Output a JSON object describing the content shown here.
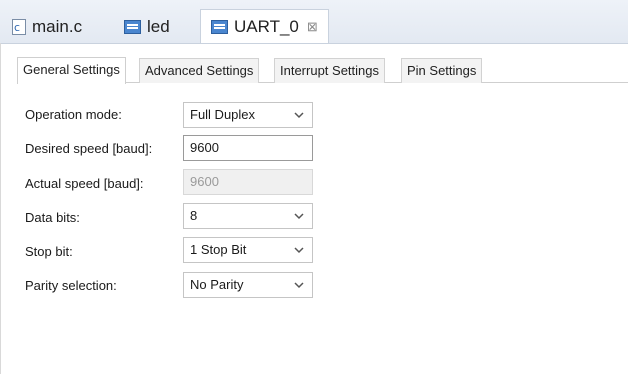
{
  "editor_tabs": [
    {
      "label": "main.c",
      "icon": "c-file-icon",
      "active": false
    },
    {
      "label": "led",
      "icon": "component-icon",
      "active": false
    },
    {
      "label": "UART_0",
      "icon": "component-icon",
      "active": true,
      "close": "⊠"
    }
  ],
  "settings_tabs": [
    {
      "label": "General Settings",
      "active": true
    },
    {
      "label": "Advanced Settings",
      "active": false
    },
    {
      "label": "Interrupt Settings",
      "active": false
    },
    {
      "label": "Pin Settings",
      "active": false
    }
  ],
  "form": {
    "operation_mode": {
      "label": "Operation mode:",
      "value": "Full Duplex"
    },
    "desired_speed": {
      "label": "Desired speed [baud]:",
      "value": "9600"
    },
    "actual_speed": {
      "label": "Actual speed [baud]:",
      "value": "9600"
    },
    "data_bits": {
      "label": "Data bits:",
      "value": "8"
    },
    "stop_bit": {
      "label": "Stop bit:",
      "value": "1 Stop Bit"
    },
    "parity": {
      "label": "Parity selection:",
      "value": "No Parity"
    }
  },
  "colors": {
    "tab_strip": "#e3e9f2",
    "icon_blue": "#4a86cf",
    "disabled_bg": "#f0f0f0"
  }
}
